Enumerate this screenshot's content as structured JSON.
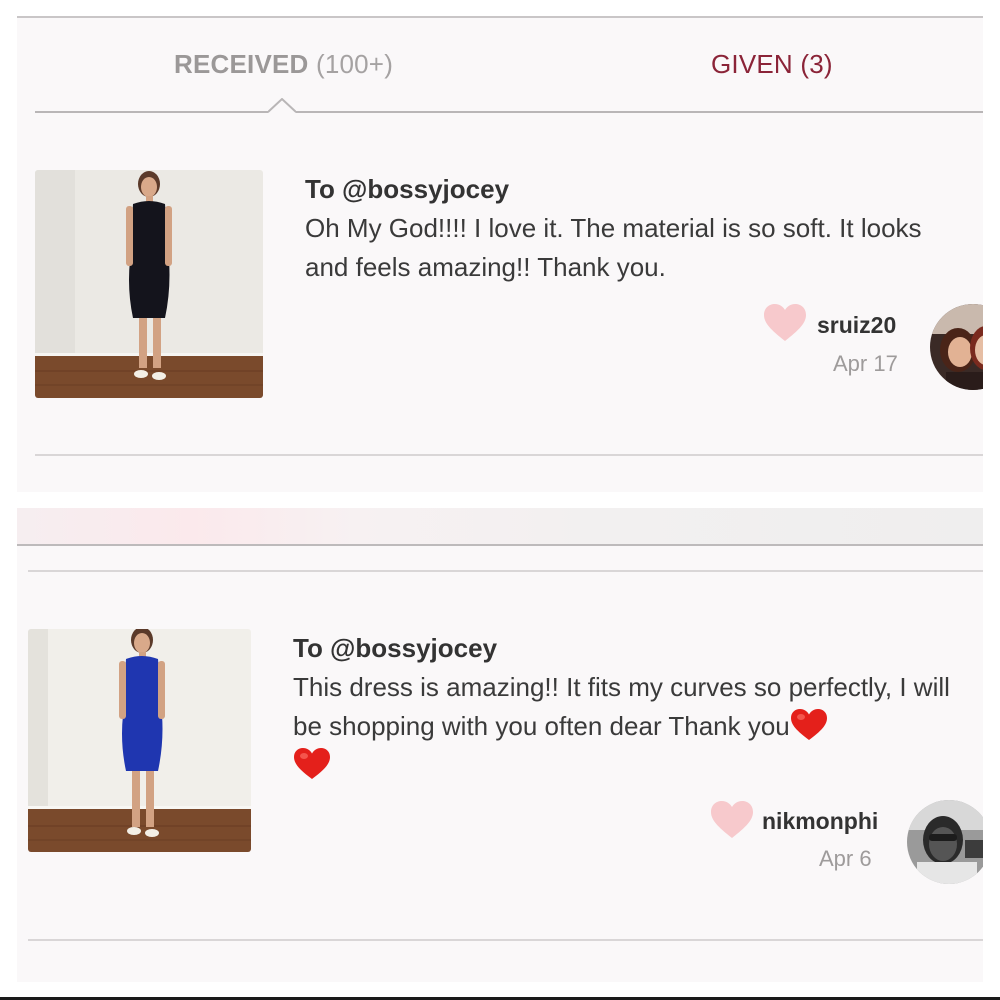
{
  "tabs": {
    "received": {
      "label": "RECEIVED",
      "count": "(100+)"
    },
    "given": {
      "label": "GIVEN (3)"
    },
    "active": "received"
  },
  "posts": [
    {
      "recipient": "To @bossyjocey",
      "message": "Oh My God!!!! I love it. The material is so soft. It looks and feels amazing!! Thank you.",
      "username": "sruiz20",
      "date": "Apr 17",
      "dress_color": "#14141c",
      "heart_icon": "heart-icon"
    },
    {
      "recipient": "To @bossyjocey",
      "message": "This dress is amazing!! It fits my curves so perfectly, I will be shopping with you often dear Thank you",
      "username": "nikmonphi",
      "date": "Apr 6",
      "dress_color": "#1f36b0",
      "heart_icon": "heart-icon",
      "emoji": "red-heart-emoji"
    }
  ],
  "colors": {
    "accent": "#8b2438",
    "tab_inactive": "#9b9898",
    "heart": "#f7c9cc",
    "background": "#faf8f9"
  }
}
